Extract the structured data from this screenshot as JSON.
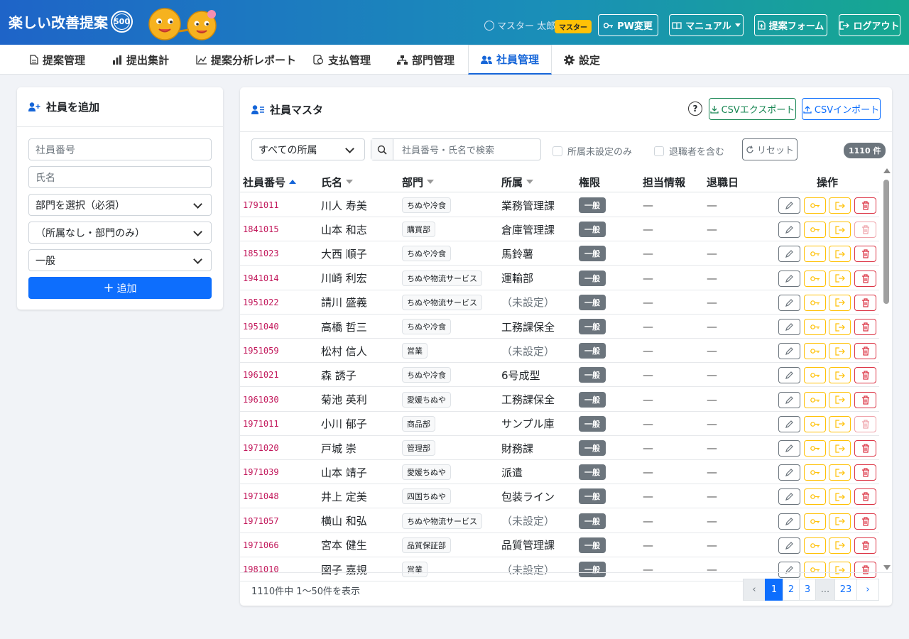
{
  "header": {
    "app_title": "楽しい改善提案",
    "badge": "500",
    "user_name": "マスター 太郎",
    "user_role_badge": "マスター",
    "buttons": {
      "pw_change": "PW変更",
      "manual": "マニュアル",
      "proposal_form": "提案フォーム",
      "logout": "ログアウト"
    }
  },
  "nav": {
    "tabs": [
      {
        "label": "提案管理",
        "icon": "document-icon"
      },
      {
        "label": "提出集計",
        "icon": "bar-chart-icon"
      },
      {
        "label": "提案分析レポート",
        "icon": "line-chart-icon"
      },
      {
        "label": "支払管理",
        "icon": "payment-icon"
      },
      {
        "label": "部門管理",
        "icon": "org-icon"
      },
      {
        "label": "社員管理",
        "icon": "people-icon",
        "active": true
      },
      {
        "label": "設定",
        "icon": "gear-icon"
      }
    ]
  },
  "add_panel": {
    "title": "社員を追加",
    "emp_no_placeholder": "社員番号",
    "name_placeholder": "氏名",
    "dept_select": "部門を選択（必須）",
    "affiliation_select": "（所属なし・部門のみ）",
    "role_select": "一般",
    "add_button": "追加"
  },
  "master": {
    "title": "社員マスタ",
    "help": "?",
    "csv_export": "CSVエクスポート",
    "csv_import": "CSVインポート",
    "filter_affiliation": "すべての所属",
    "search_placeholder": "社員番号・氏名で検索",
    "chk_unassigned": "所属未設定のみ",
    "chk_retired": "退職者を含む",
    "reset": "リセット",
    "count_badge": "1110 件",
    "columns": [
      "社員番号",
      "氏名",
      "部門",
      "所属",
      "権限",
      "担当情報",
      "退職日",
      "操作"
    ],
    "rows": [
      {
        "no": "1791011",
        "name": "川人 寿美",
        "dept": "ちぬや冷食",
        "aff": "業務管理課",
        "role": "一般",
        "charge": "—",
        "retired": "—",
        "del_enabled": true
      },
      {
        "no": "1841015",
        "name": "山本 和志",
        "dept": "購買部",
        "aff": "倉庫管理課",
        "role": "一般",
        "charge": "—",
        "retired": "—",
        "del_enabled": false
      },
      {
        "no": "1851023",
        "name": "大西 順子",
        "dept": "ちぬや冷食",
        "aff": "馬鈴薯",
        "role": "一般",
        "charge": "—",
        "retired": "—",
        "del_enabled": true
      },
      {
        "no": "1941014",
        "name": "川崎 利宏",
        "dept": "ちぬや物流サービス",
        "aff": "運輸部",
        "role": "一般",
        "charge": "—",
        "retired": "—",
        "del_enabled": true
      },
      {
        "no": "1951022",
        "name": "請川 盛義",
        "dept": "ちぬや物流サービス",
        "aff": "（未設定）",
        "unset": true,
        "role": "一般",
        "charge": "—",
        "retired": "—",
        "del_enabled": true
      },
      {
        "no": "1951040",
        "name": "高橋 哲三",
        "dept": "ちぬや冷食",
        "aff": "工務課保全",
        "role": "一般",
        "charge": "—",
        "retired": "—",
        "del_enabled": true
      },
      {
        "no": "1951059",
        "name": "松村 信人",
        "dept": "営業",
        "aff": "（未設定）",
        "unset": true,
        "role": "一般",
        "charge": "—",
        "retired": "—",
        "del_enabled": true
      },
      {
        "no": "1961021",
        "name": "森 誘子",
        "dept": "ちぬや冷食",
        "aff": "6号成型",
        "role": "一般",
        "charge": "—",
        "retired": "—",
        "del_enabled": true
      },
      {
        "no": "1961030",
        "name": "菊池 英利",
        "dept": "愛媛ちぬや",
        "aff": "工務課保全",
        "role": "一般",
        "charge": "—",
        "retired": "—",
        "del_enabled": true
      },
      {
        "no": "1971011",
        "name": "小川 郁子",
        "dept": "商品部",
        "aff": "サンプル庫",
        "role": "一般",
        "charge": "—",
        "retired": "—",
        "del_enabled": false
      },
      {
        "no": "1971020",
        "name": "戸城 崇",
        "dept": "管理部",
        "aff": "財務課",
        "role": "一般",
        "charge": "—",
        "retired": "—",
        "del_enabled": true
      },
      {
        "no": "1971039",
        "name": "山本 靖子",
        "dept": "愛媛ちぬや",
        "aff": "派遣",
        "role": "一般",
        "charge": "—",
        "retired": "—",
        "del_enabled": true
      },
      {
        "no": "1971048",
        "name": "井上 定美",
        "dept": "四国ちぬや",
        "aff": "包装ライン",
        "role": "一般",
        "charge": "—",
        "retired": "—",
        "del_enabled": true
      },
      {
        "no": "1971057",
        "name": "横山 和弘",
        "dept": "ちぬや物流サービス",
        "aff": "（未設定）",
        "unset": true,
        "role": "一般",
        "charge": "—",
        "retired": "—",
        "del_enabled": true
      },
      {
        "no": "1971066",
        "name": "宮本 健生",
        "dept": "品質保証部",
        "aff": "品質管理課",
        "role": "一般",
        "charge": "—",
        "retired": "—",
        "del_enabled": true
      },
      {
        "no": "1981010",
        "name": "図子 嘉規",
        "dept": "営業",
        "aff": "（未設定）",
        "unset": true,
        "role": "一般",
        "charge": "—",
        "retired": "—",
        "del_enabled": true
      }
    ],
    "footer_text": "1110件中 1〜50件を表示",
    "pagination": [
      "‹",
      "1",
      "2",
      "3",
      "...",
      "23",
      "›"
    ],
    "current_page": "1"
  },
  "colors": {
    "primary": "#0d6efd",
    "active_tab": "#1565d8",
    "emp_no": "#c2185b",
    "edit": "#6c757d",
    "key": "#ffc107",
    "delete": "#dc3545",
    "success": "#198754"
  }
}
